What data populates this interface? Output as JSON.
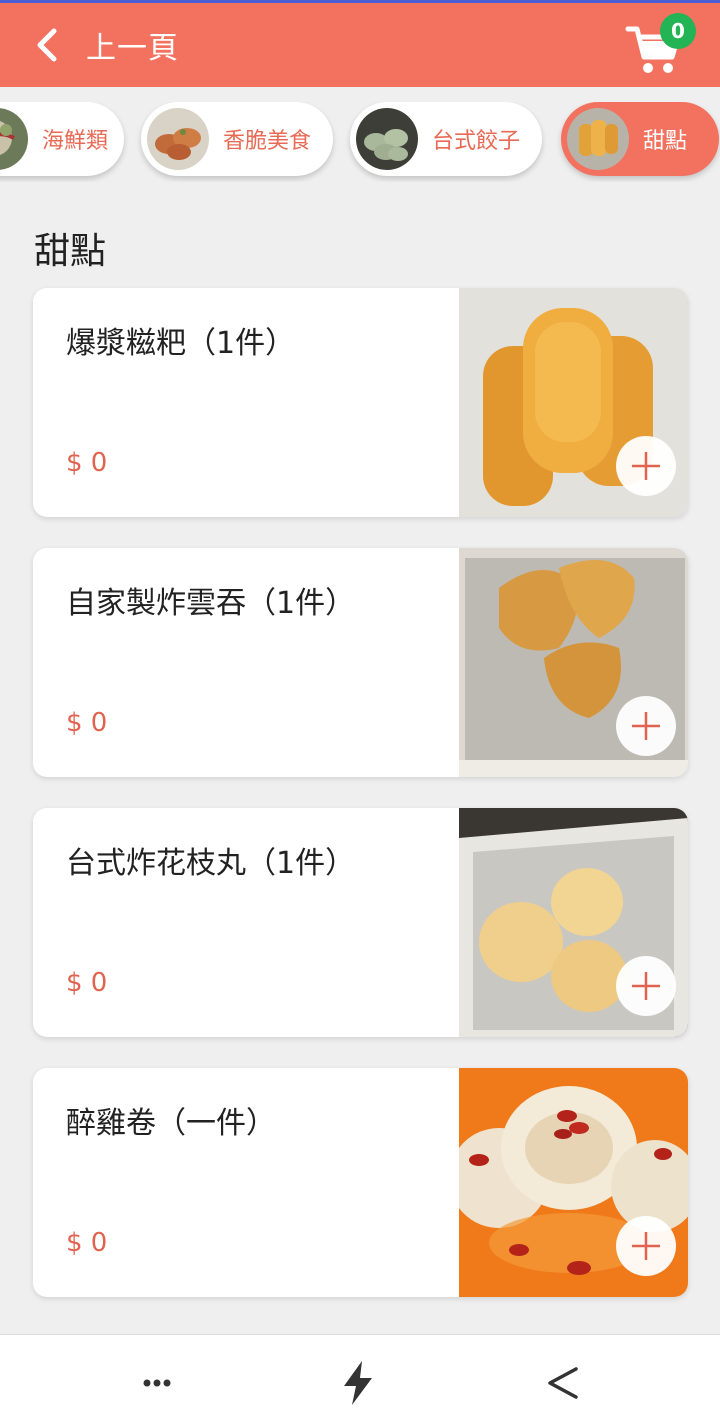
{
  "header": {
    "back_label": "上一頁",
    "cart_count": "0",
    "color": "#f2725f"
  },
  "categories": [
    {
      "label": "海鮮類",
      "active": false,
      "icon": "seafood-thumb"
    },
    {
      "label": "香脆美食",
      "active": false,
      "icon": "crispy-food-thumb"
    },
    {
      "label": "台式餃子",
      "active": false,
      "icon": "dumplings-thumb"
    },
    {
      "label": "甜點",
      "active": true,
      "icon": "dessert-thumb"
    }
  ],
  "section_title": "甜點",
  "items": [
    {
      "name": "爆漿糍粑（1件）",
      "price": "$ 0"
    },
    {
      "name": "自家製炸雲吞（1件）",
      "price": "$ 0"
    },
    {
      "name": "台式炸花枝丸（1件）",
      "price": "$ 0"
    },
    {
      "name": "醉雞卷（一件）",
      "price": "$ 0"
    }
  ],
  "bottom_nav": {
    "icons": [
      "more-dots-icon",
      "lightning-icon",
      "back-arrow-icon"
    ]
  },
  "colors": {
    "accent": "#f2725f",
    "price": "#e06350",
    "badge": "#22b455"
  }
}
